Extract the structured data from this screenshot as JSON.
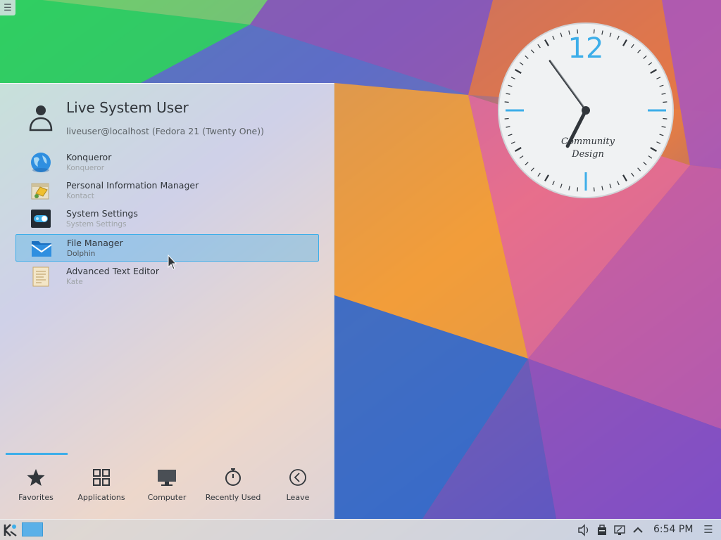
{
  "launcher": {
    "user": {
      "name": "Live System User",
      "host": "liveuser@localhost (Fedora 21 (Twenty One))"
    },
    "favorites": [
      {
        "title": "Konqueror",
        "subtitle": "Konqueror",
        "icon": "globe-icon"
      },
      {
        "title": "Personal Information Manager",
        "subtitle": "Kontact",
        "icon": "kontact-icon"
      },
      {
        "title": "System Settings",
        "subtitle": "System Settings",
        "icon": "toggle-settings-icon"
      },
      {
        "title": "File Manager",
        "subtitle": "Dolphin",
        "icon": "folder-icon",
        "selected": true
      },
      {
        "title": "Advanced Text Editor",
        "subtitle": "Kate",
        "icon": "text-editor-icon"
      }
    ],
    "tabs": [
      {
        "label": "Favorites",
        "icon": "star-icon",
        "active": true
      },
      {
        "label": "Applications",
        "icon": "grid-icon"
      },
      {
        "label": "Computer",
        "icon": "monitor-icon"
      },
      {
        "label": "Recently Used",
        "icon": "clock-icon"
      },
      {
        "label": "Leave",
        "icon": "arrow-left-circle-icon"
      }
    ]
  },
  "clock_widget": {
    "numeral": "12",
    "brand_line1": "Community",
    "brand_line2": "Design",
    "time": {
      "hour": 6,
      "minute": 54
    },
    "accent": "#3daee9"
  },
  "panel": {
    "clock_text": "6:54 PM",
    "tray": [
      "volume-icon",
      "device-notifier-icon",
      "display-icon",
      "expand-up-icon"
    ],
    "menu_glyph": "☰"
  },
  "colors": {
    "accent": "#3daee9",
    "text": "#31363b"
  }
}
